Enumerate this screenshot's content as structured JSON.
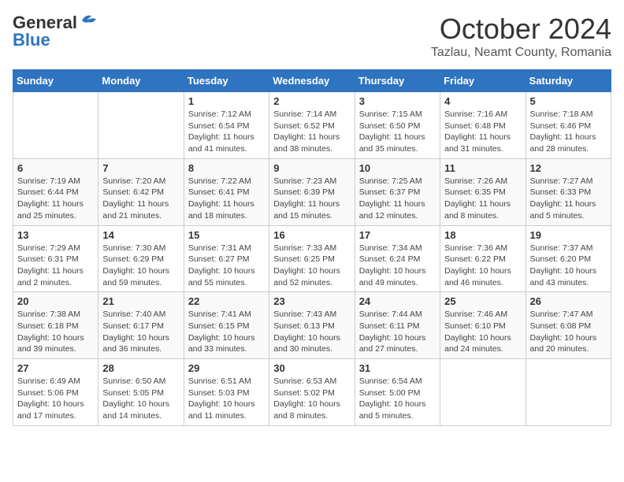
{
  "header": {
    "logo_line1": "General",
    "logo_line2": "Blue",
    "month": "October 2024",
    "location": "Tazlau, Neamt County, Romania"
  },
  "days_of_week": [
    "Sunday",
    "Monday",
    "Tuesday",
    "Wednesday",
    "Thursday",
    "Friday",
    "Saturday"
  ],
  "weeks": [
    [
      {
        "day": "",
        "info": ""
      },
      {
        "day": "",
        "info": ""
      },
      {
        "day": "1",
        "info": "Sunrise: 7:12 AM\nSunset: 6:54 PM\nDaylight: 11 hours and 41 minutes."
      },
      {
        "day": "2",
        "info": "Sunrise: 7:14 AM\nSunset: 6:52 PM\nDaylight: 11 hours and 38 minutes."
      },
      {
        "day": "3",
        "info": "Sunrise: 7:15 AM\nSunset: 6:50 PM\nDaylight: 11 hours and 35 minutes."
      },
      {
        "day": "4",
        "info": "Sunrise: 7:16 AM\nSunset: 6:48 PM\nDaylight: 11 hours and 31 minutes."
      },
      {
        "day": "5",
        "info": "Sunrise: 7:18 AM\nSunset: 6:46 PM\nDaylight: 11 hours and 28 minutes."
      }
    ],
    [
      {
        "day": "6",
        "info": "Sunrise: 7:19 AM\nSunset: 6:44 PM\nDaylight: 11 hours and 25 minutes."
      },
      {
        "day": "7",
        "info": "Sunrise: 7:20 AM\nSunset: 6:42 PM\nDaylight: 11 hours and 21 minutes."
      },
      {
        "day": "8",
        "info": "Sunrise: 7:22 AM\nSunset: 6:41 PM\nDaylight: 11 hours and 18 minutes."
      },
      {
        "day": "9",
        "info": "Sunrise: 7:23 AM\nSunset: 6:39 PM\nDaylight: 11 hours and 15 minutes."
      },
      {
        "day": "10",
        "info": "Sunrise: 7:25 AM\nSunset: 6:37 PM\nDaylight: 11 hours and 12 minutes."
      },
      {
        "day": "11",
        "info": "Sunrise: 7:26 AM\nSunset: 6:35 PM\nDaylight: 11 hours and 8 minutes."
      },
      {
        "day": "12",
        "info": "Sunrise: 7:27 AM\nSunset: 6:33 PM\nDaylight: 11 hours and 5 minutes."
      }
    ],
    [
      {
        "day": "13",
        "info": "Sunrise: 7:29 AM\nSunset: 6:31 PM\nDaylight: 11 hours and 2 minutes."
      },
      {
        "day": "14",
        "info": "Sunrise: 7:30 AM\nSunset: 6:29 PM\nDaylight: 10 hours and 59 minutes."
      },
      {
        "day": "15",
        "info": "Sunrise: 7:31 AM\nSunset: 6:27 PM\nDaylight: 10 hours and 55 minutes."
      },
      {
        "day": "16",
        "info": "Sunrise: 7:33 AM\nSunset: 6:25 PM\nDaylight: 10 hours and 52 minutes."
      },
      {
        "day": "17",
        "info": "Sunrise: 7:34 AM\nSunset: 6:24 PM\nDaylight: 10 hours and 49 minutes."
      },
      {
        "day": "18",
        "info": "Sunrise: 7:36 AM\nSunset: 6:22 PM\nDaylight: 10 hours and 46 minutes."
      },
      {
        "day": "19",
        "info": "Sunrise: 7:37 AM\nSunset: 6:20 PM\nDaylight: 10 hours and 43 minutes."
      }
    ],
    [
      {
        "day": "20",
        "info": "Sunrise: 7:38 AM\nSunset: 6:18 PM\nDaylight: 10 hours and 39 minutes."
      },
      {
        "day": "21",
        "info": "Sunrise: 7:40 AM\nSunset: 6:17 PM\nDaylight: 10 hours and 36 minutes."
      },
      {
        "day": "22",
        "info": "Sunrise: 7:41 AM\nSunset: 6:15 PM\nDaylight: 10 hours and 33 minutes."
      },
      {
        "day": "23",
        "info": "Sunrise: 7:43 AM\nSunset: 6:13 PM\nDaylight: 10 hours and 30 minutes."
      },
      {
        "day": "24",
        "info": "Sunrise: 7:44 AM\nSunset: 6:11 PM\nDaylight: 10 hours and 27 minutes."
      },
      {
        "day": "25",
        "info": "Sunrise: 7:46 AM\nSunset: 6:10 PM\nDaylight: 10 hours and 24 minutes."
      },
      {
        "day": "26",
        "info": "Sunrise: 7:47 AM\nSunset: 6:08 PM\nDaylight: 10 hours and 20 minutes."
      }
    ],
    [
      {
        "day": "27",
        "info": "Sunrise: 6:49 AM\nSunset: 5:06 PM\nDaylight: 10 hours and 17 minutes."
      },
      {
        "day": "28",
        "info": "Sunrise: 6:50 AM\nSunset: 5:05 PM\nDaylight: 10 hours and 14 minutes."
      },
      {
        "day": "29",
        "info": "Sunrise: 6:51 AM\nSunset: 5:03 PM\nDaylight: 10 hours and 11 minutes."
      },
      {
        "day": "30",
        "info": "Sunrise: 6:53 AM\nSunset: 5:02 PM\nDaylight: 10 hours and 8 minutes."
      },
      {
        "day": "31",
        "info": "Sunrise: 6:54 AM\nSunset: 5:00 PM\nDaylight: 10 hours and 5 minutes."
      },
      {
        "day": "",
        "info": ""
      },
      {
        "day": "",
        "info": ""
      }
    ]
  ]
}
